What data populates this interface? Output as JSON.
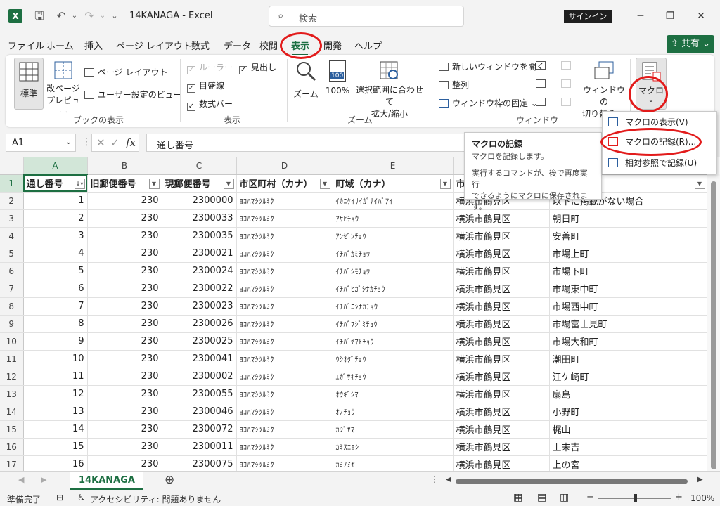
{
  "window": {
    "app_icon": "X",
    "doc_title": "14KANAGA  -  Excel",
    "search_placeholder": "検索",
    "signin": "サインイン"
  },
  "tabs": [
    "ファイル",
    "ホーム",
    "挿入",
    "ページ レイアウト",
    "数式",
    "データ",
    "校閲",
    "表示",
    "開発",
    "ヘルプ"
  ],
  "active_tab": "表示",
  "share_label": "共有",
  "ribbon": {
    "book_view": {
      "label": "ブックの表示",
      "normal": "標準",
      "page_break_1": "改ページ",
      "page_break_2": "プレビュー",
      "page_layout": "ページ レイアウト",
      "custom_view": "ユーザー設定のビュー"
    },
    "show": {
      "label": "表示",
      "ruler": "ルーラー",
      "headings": "見出し",
      "gridlines": "目盛線",
      "formula_bar": "数式バー"
    },
    "zoom": {
      "label": "ズーム",
      "zoom": "ズーム",
      "zoom100": "100%",
      "zoom100_icon": "100",
      "fit_1": "選択範囲に合わせて",
      "fit_2": "拡大/縮小"
    },
    "window": {
      "label": "ウィンドウ",
      "new_window": "新しいウィンドウを開く",
      "arrange": "整列",
      "freeze": "ウィンドウ枠の固定",
      "switch_1": "ウィンドウの",
      "switch_2": "切り替え"
    },
    "macro": {
      "label": "マクロ"
    }
  },
  "formula_bar": {
    "name_box": "A1",
    "fx": "fx",
    "content": "通し番号"
  },
  "tooltip": {
    "title": "マクロの記録",
    "line1": "マクロを記録します。",
    "line2": "実行するコマンドが、後で再度実行",
    "line3": "できるようにマクロに保存されます。"
  },
  "macro_menu": {
    "view": "マクロの表示(V)",
    "record": "マクロの記録(R)...",
    "relative": "相対参照で記録(U)"
  },
  "sheet": {
    "columns": [
      "A",
      "B",
      "C",
      "D",
      "E",
      "F",
      "G"
    ],
    "headers": [
      "通し番号",
      "旧郵便番号",
      "現郵便番号",
      "市区町村（カナ）",
      "町域（カナ）",
      "市",
      ""
    ],
    "rows": [
      [
        "2",
        "1",
        "230",
        "2300000",
        "ﾖｺﾊﾏｼﾂﾙﾐｸ",
        "ｲｶﾆｹｲｻｲｶﾞﾅｲﾊﾞｱｲ",
        "横浜市鶴見区",
        "以下に掲載がない場合"
      ],
      [
        "3",
        "2",
        "230",
        "2300033",
        "ﾖｺﾊﾏｼﾂﾙﾐｸ",
        "ｱｻﾋﾁｮｳ",
        "横浜市鶴見区",
        "朝日町"
      ],
      [
        "4",
        "3",
        "230",
        "2300035",
        "ﾖｺﾊﾏｼﾂﾙﾐｸ",
        "ｱﾝｾﾞﾝﾁｮｳ",
        "横浜市鶴見区",
        "安善町"
      ],
      [
        "5",
        "4",
        "230",
        "2300021",
        "ﾖｺﾊﾏｼﾂﾙﾐｸ",
        "ｲﾁﾊﾞｶﾐﾁｮｳ",
        "横浜市鶴見区",
        "市場上町"
      ],
      [
        "6",
        "5",
        "230",
        "2300024",
        "ﾖｺﾊﾏｼﾂﾙﾐｸ",
        "ｲﾁﾊﾞｼﾓﾁｮｳ",
        "横浜市鶴見区",
        "市場下町"
      ],
      [
        "7",
        "6",
        "230",
        "2300022",
        "ﾖｺﾊﾏｼﾂﾙﾐｸ",
        "ｲﾁﾊﾞﾋｶﾞｼﾅｶﾁｮｳ",
        "横浜市鶴見区",
        "市場東中町"
      ],
      [
        "8",
        "7",
        "230",
        "2300023",
        "ﾖｺﾊﾏｼﾂﾙﾐｸ",
        "ｲﾁﾊﾞﾆｼﾅｶﾁｮｳ",
        "横浜市鶴見区",
        "市場西中町"
      ],
      [
        "9",
        "8",
        "230",
        "2300026",
        "ﾖｺﾊﾏｼﾂﾙﾐｸ",
        "ｲﾁﾊﾞﾌｼﾞﾐﾁｮｳ",
        "横浜市鶴見区",
        "市場富士見町"
      ],
      [
        "10",
        "9",
        "230",
        "2300025",
        "ﾖｺﾊﾏｼﾂﾙﾐｸ",
        "ｲﾁﾊﾞﾔﾏﾄﾁｮｳ",
        "横浜市鶴見区",
        "市場大和町"
      ],
      [
        "11",
        "10",
        "230",
        "2300041",
        "ﾖｺﾊﾏｼﾂﾙﾐｸ",
        "ｳｼｵﾀﾞﾁｮｳ",
        "横浜市鶴見区",
        "潮田町"
      ],
      [
        "12",
        "11",
        "230",
        "2300002",
        "ﾖｺﾊﾏｼﾂﾙﾐｸ",
        "ｴｶﾞｻｷﾁｮｳ",
        "横浜市鶴見区",
        "江ケ崎町"
      ],
      [
        "13",
        "12",
        "230",
        "2300055",
        "ﾖｺﾊﾏｼﾂﾙﾐｸ",
        "ｵｳｷﾞｼﾏ",
        "横浜市鶴見区",
        "扇島"
      ],
      [
        "14",
        "13",
        "230",
        "2300046",
        "ﾖｺﾊﾏｼﾂﾙﾐｸ",
        "ｵﾉﾁｮｳ",
        "横浜市鶴見区",
        "小野町"
      ],
      [
        "15",
        "14",
        "230",
        "2300072",
        "ﾖｺﾊﾏｼﾂﾙﾐｸ",
        "ｶｼﾞﾔﾏ",
        "横浜市鶴見区",
        "梶山"
      ],
      [
        "16",
        "15",
        "230",
        "2300011",
        "ﾖｺﾊﾏｼﾂﾙﾐｸ",
        "ｶﾐｽｴﾖｼ",
        "横浜市鶴見区",
        "上末吉"
      ],
      [
        "17",
        "16",
        "230",
        "2300075",
        "ﾖｺﾊﾏｼﾂﾙﾐｸ",
        "ｶﾐﾉﾐﾔ",
        "横浜市鶴見区",
        "上の宮"
      ]
    ],
    "sheet_tab": "14KANAGA",
    "add_sheet": "⊕"
  },
  "status": {
    "ready": "準備完了",
    "accessibility": "アクセシビリティ: 問題ありません",
    "zoom": "100%"
  },
  "colors": {
    "excel_green": "#1d6f42",
    "annotation_red": "#e21b1b"
  }
}
